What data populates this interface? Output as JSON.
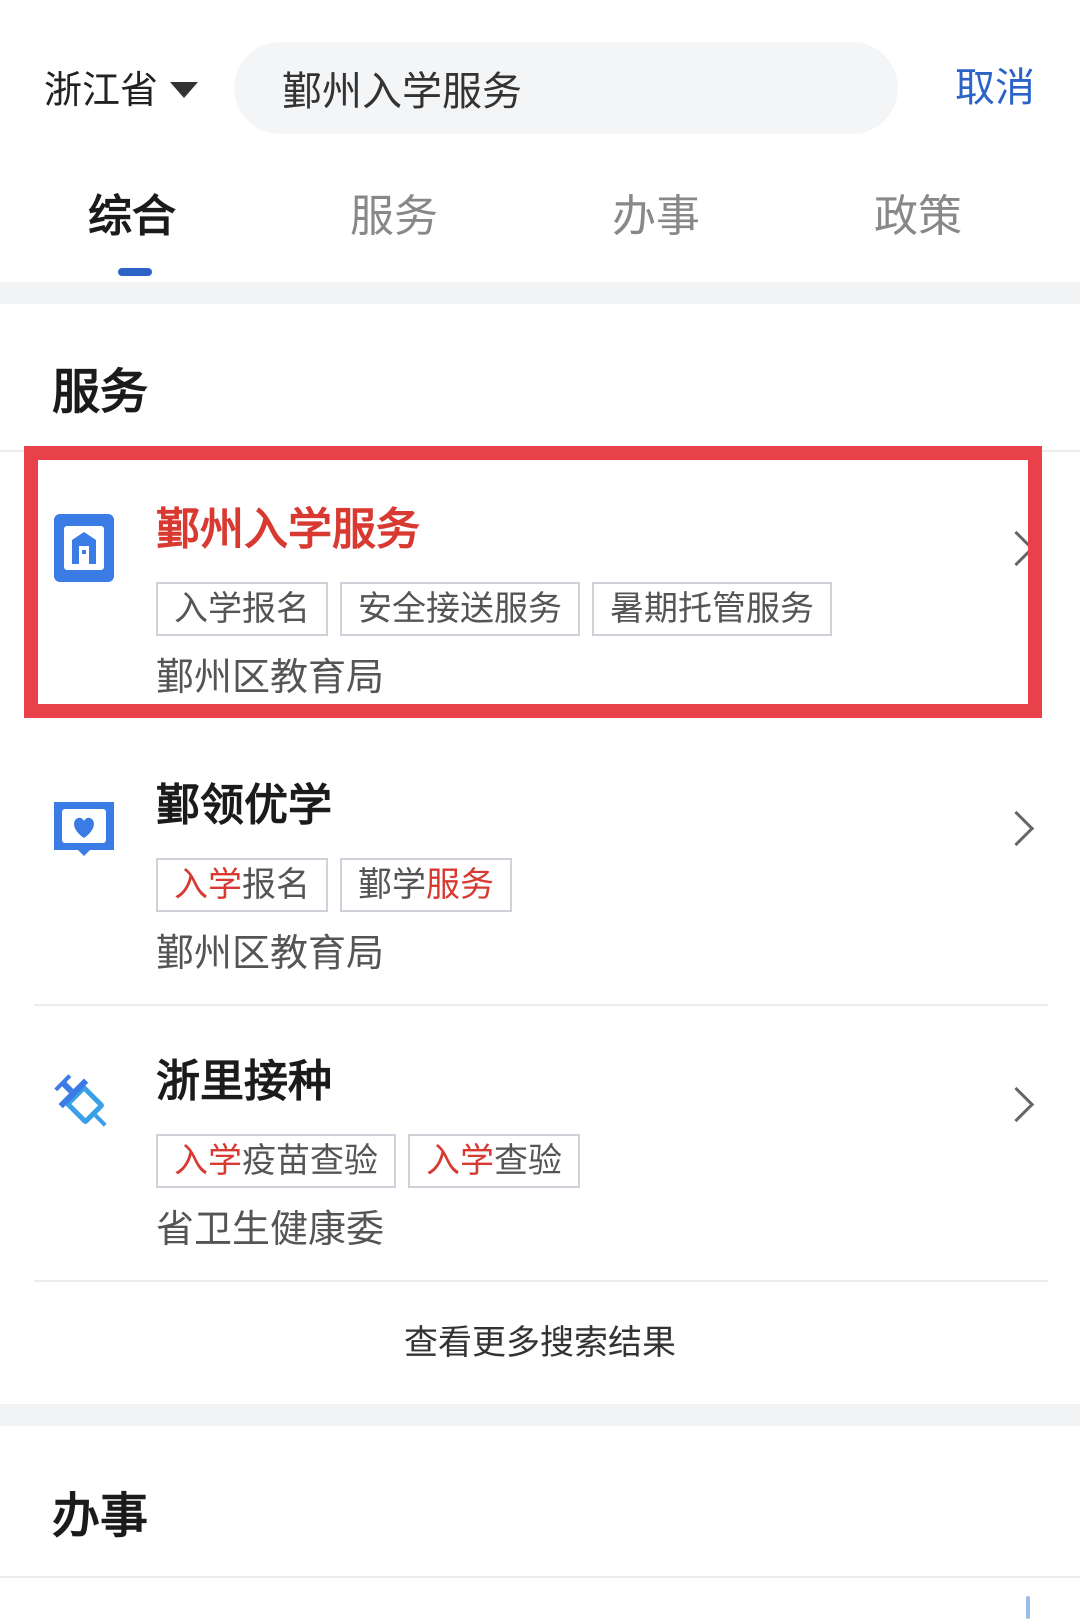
{
  "header": {
    "region": "浙江省",
    "search_value": "鄞州入学服务",
    "cancel_label": "取消"
  },
  "tabs": [
    {
      "label": "综合",
      "active": true
    },
    {
      "label": "服务",
      "active": false
    },
    {
      "label": "办事",
      "active": false
    },
    {
      "label": "政策",
      "active": false
    }
  ],
  "services_section": {
    "title": "服务",
    "cards": [
      {
        "title": "鄞州入学服务",
        "icon": "building-icon",
        "highlighted": true,
        "tags": [
          "入学报名",
          "安全接送服务",
          "暑期托管服务"
        ],
        "org": "鄞州区教育局"
      },
      {
        "title": "鄞领优学",
        "icon": "book-heart-icon",
        "highlighted": false,
        "tags": [
          {
            "hl": "入学",
            "rest": "报名"
          },
          {
            "pre": "鄞学",
            "hl": "服务"
          }
        ],
        "org": "鄞州区教育局"
      },
      {
        "title": "浙里接种",
        "icon": "syringe-icon",
        "highlighted": false,
        "tags": [
          {
            "hl": "入学",
            "rest": "疫苗查验"
          },
          {
            "hl": "入学",
            "rest": "查验"
          }
        ],
        "org": "省卫生健康委"
      }
    ],
    "more_label": "查看更多搜索结果"
  },
  "affairs_section": {
    "title": "办事"
  },
  "colors": {
    "accent_blue": "#2b63c7",
    "highlight_red": "#e8414a",
    "title_red": "#d83a32"
  }
}
